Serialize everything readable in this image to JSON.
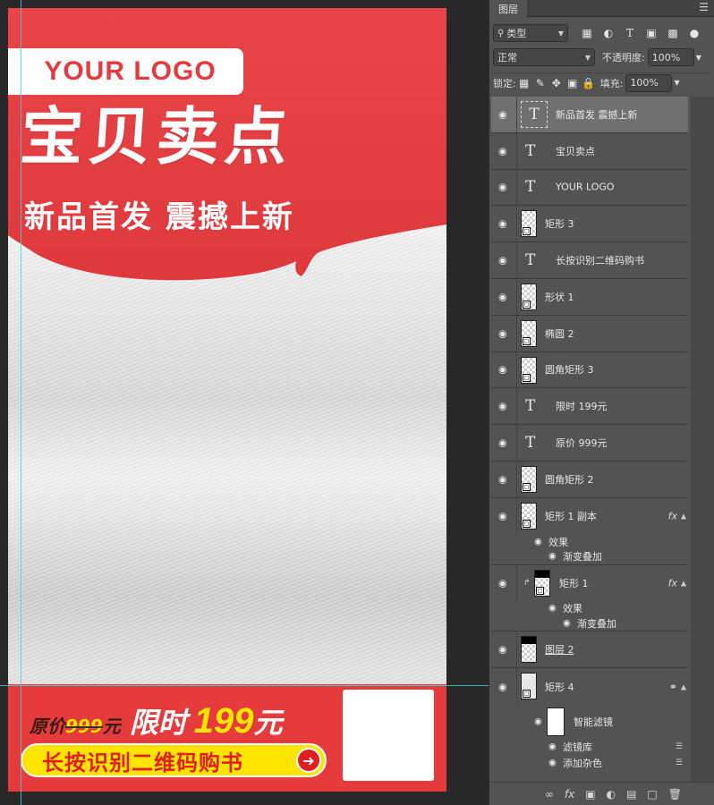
{
  "canvas": {
    "logo_text": "YOUR LOGO",
    "title_main": "宝贝卖点",
    "title_sub": "新品首发  震撼上新",
    "price": {
      "orig_label": "原价",
      "orig_value": "999",
      "orig_unit": "元",
      "limit_label": "限时",
      "limit_value": "199",
      "limit_unit": "元"
    },
    "cta_text": "长按识别二维码购书",
    "cta_icon": "arrow-right-icon",
    "colors": {
      "red": "#e23c40",
      "yellow": "#ffe400",
      "white": "#ffffff"
    }
  },
  "panel": {
    "tab_label": "图层",
    "filter_kind": "类型",
    "blend_mode": "正常",
    "opacity_label": "不透明度:",
    "opacity_value": "100%",
    "lock_label": "锁定:",
    "fill_label": "填充:",
    "fill_value": "100%",
    "layers": [
      {
        "name": "新品首发 震撼上新",
        "kind": "text",
        "selected": true
      },
      {
        "name": "宝贝卖点",
        "kind": "text"
      },
      {
        "name": "YOUR LOGO",
        "kind": "text"
      },
      {
        "name": "矩形 3",
        "kind": "shape"
      },
      {
        "name": "长按识别二维码购书",
        "kind": "text"
      },
      {
        "name": "形状 1",
        "kind": "shape"
      },
      {
        "name": "椭圆 2",
        "kind": "shape"
      },
      {
        "name": "圆角矩形 3",
        "kind": "shape"
      },
      {
        "name": "限时 199元",
        "kind": "text"
      },
      {
        "name": "原价 999元",
        "kind": "text"
      },
      {
        "name": "圆角矩形 2",
        "kind": "shape"
      },
      {
        "name": "矩形 1 副本",
        "kind": "shape",
        "fx": "fx",
        "effects_label": "效果",
        "effect": "渐变叠加"
      },
      {
        "name": "矩形 1",
        "kind": "shape-black",
        "fx": "fx",
        "effects_label": "效果",
        "effect": "渐变叠加"
      },
      {
        "name": "图层 2",
        "kind": "image"
      },
      {
        "name": "矩形 4",
        "kind": "smart",
        "smart_filter_label": "智能滤镜",
        "filters": [
          "滤镜库",
          "添加杂色"
        ]
      }
    ],
    "bottom_icons": [
      "link-icon",
      "fx-icon",
      "mask-icon",
      "adjustment-icon",
      "folder-icon",
      "new-layer-icon",
      "trash-icon"
    ]
  }
}
